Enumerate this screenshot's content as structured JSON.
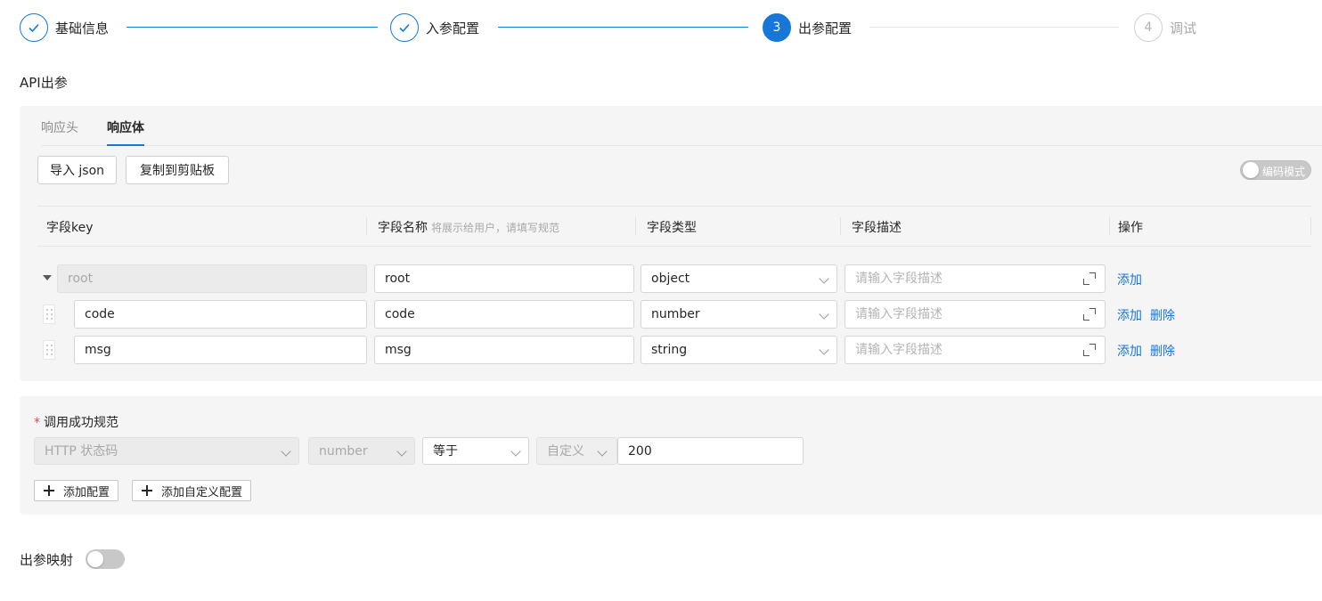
{
  "steps": [
    {
      "index": "1",
      "title": "基础信息",
      "status": "done"
    },
    {
      "index": "2",
      "title": "入参配置",
      "status": "done"
    },
    {
      "index": "3",
      "title": "出参配置",
      "status": "active"
    },
    {
      "index": "4",
      "title": "调试",
      "status": "wait"
    }
  ],
  "section_title": "API出参",
  "tabs": [
    {
      "label": "响应头",
      "active": false
    },
    {
      "label": "响应体",
      "active": true
    }
  ],
  "toolbar": {
    "import_json": "导入 json",
    "copy_clipboard": "复制到剪贴板",
    "code_mode_label": "编码模式"
  },
  "table": {
    "columns": {
      "key": "字段key",
      "name": "字段名称",
      "name_hint": "将展示给用户，请填写规范",
      "type": "字段类型",
      "desc": "字段描述",
      "ops": "操作"
    },
    "desc_placeholder": "请输入字段描述",
    "add_label": "添加",
    "delete_label": "删除",
    "rows": [
      {
        "key": "root",
        "name": "root",
        "type": "object"
      },
      {
        "key": "code",
        "name": "code",
        "type": "number"
      },
      {
        "key": "msg",
        "name": "msg",
        "type": "string"
      }
    ]
  },
  "success_rule": {
    "label": "调用成功规范",
    "source": "HTTP 状态码",
    "value_type": "number",
    "operator": "等于",
    "mode": "自定义",
    "value": "200",
    "add_config": "添加配置",
    "add_custom_config": "添加自定义配置"
  },
  "output_mapping": {
    "label": "出参映射",
    "enabled": false
  },
  "colors": {
    "primary": "#1677d9",
    "panel_bg": "#f5f5f5",
    "required": "#e5484d"
  }
}
